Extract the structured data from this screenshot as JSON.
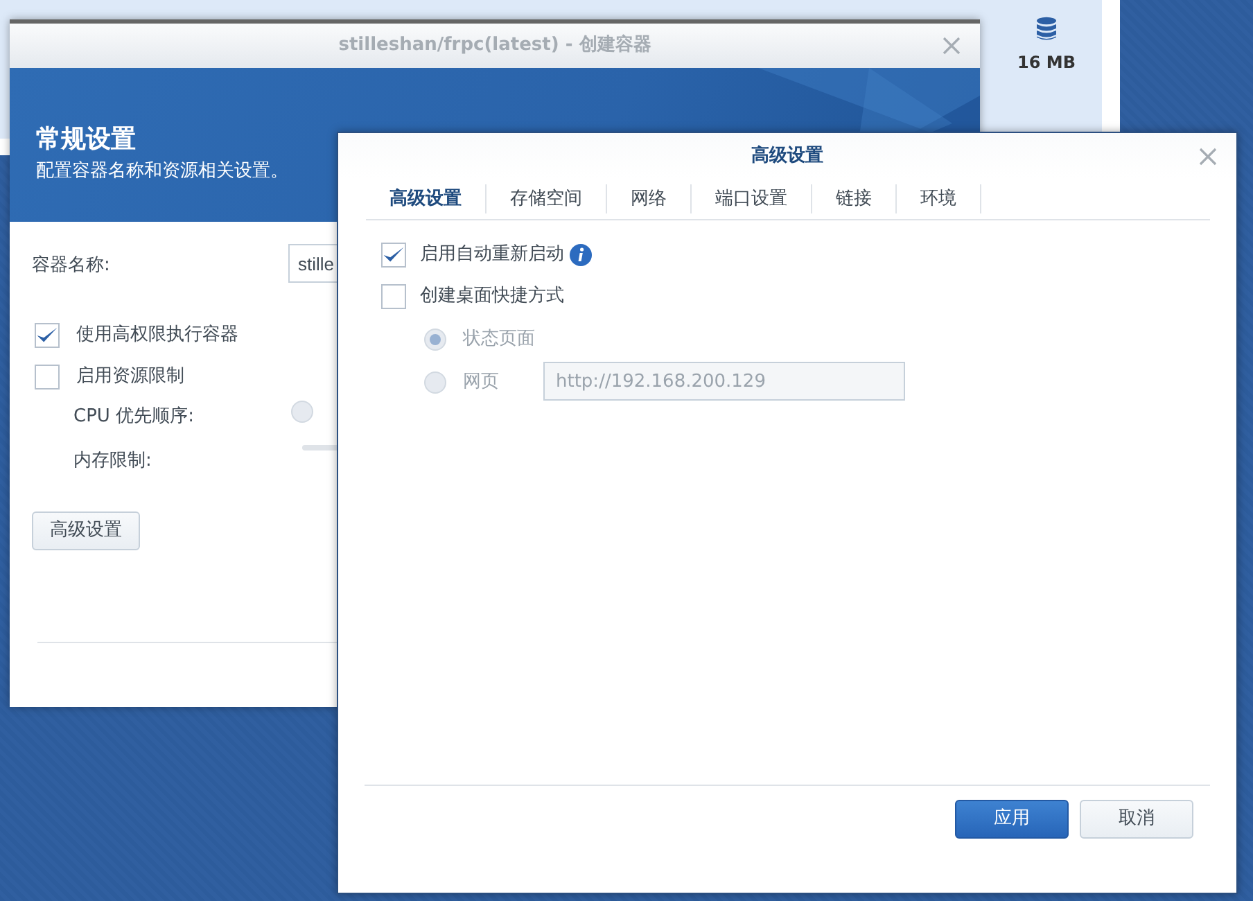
{
  "background_panel": {
    "storage": "16 MB"
  },
  "main_window": {
    "title": "stilleshan/frpc(latest) - 创建容器",
    "header_title": "常规设置",
    "header_subtitle": "配置容器名称和资源相关设置。",
    "name_label": "容器名称:",
    "name_value": "stille",
    "options": [
      {
        "label": "使用高权限执行容器",
        "checked": true
      },
      {
        "label": "启用资源限制",
        "checked": false
      }
    ],
    "cpu_label": "CPU 优先顺序:",
    "cpu_radio": {
      "selected": false
    },
    "memory_label": "内存限制:",
    "advanced_button": "高级设置"
  },
  "dialog": {
    "title": "高级设置",
    "tabs": [
      {
        "label": "高级设置",
        "selected": true
      },
      {
        "label": "存储空间",
        "selected": false
      },
      {
        "label": "网络",
        "selected": false
      },
      {
        "label": "端口设置",
        "selected": false
      },
      {
        "label": "链接",
        "selected": false
      },
      {
        "label": "环境",
        "selected": false
      }
    ],
    "auto_restart": {
      "label": "启用自动重新启动",
      "checked": true
    },
    "shortcut": {
      "label": "创建桌面快捷方式",
      "checked": false
    },
    "shortcut_options": [
      {
        "label": "状态页面",
        "selected": true,
        "disabled": true
      },
      {
        "label": "网页",
        "selected": false,
        "disabled": true
      }
    ],
    "url_value": "http://192.168.200.129",
    "buttons": [
      {
        "label": "应用",
        "kind": "primary"
      },
      {
        "label": "取消",
        "kind": "secondary"
      }
    ]
  }
}
